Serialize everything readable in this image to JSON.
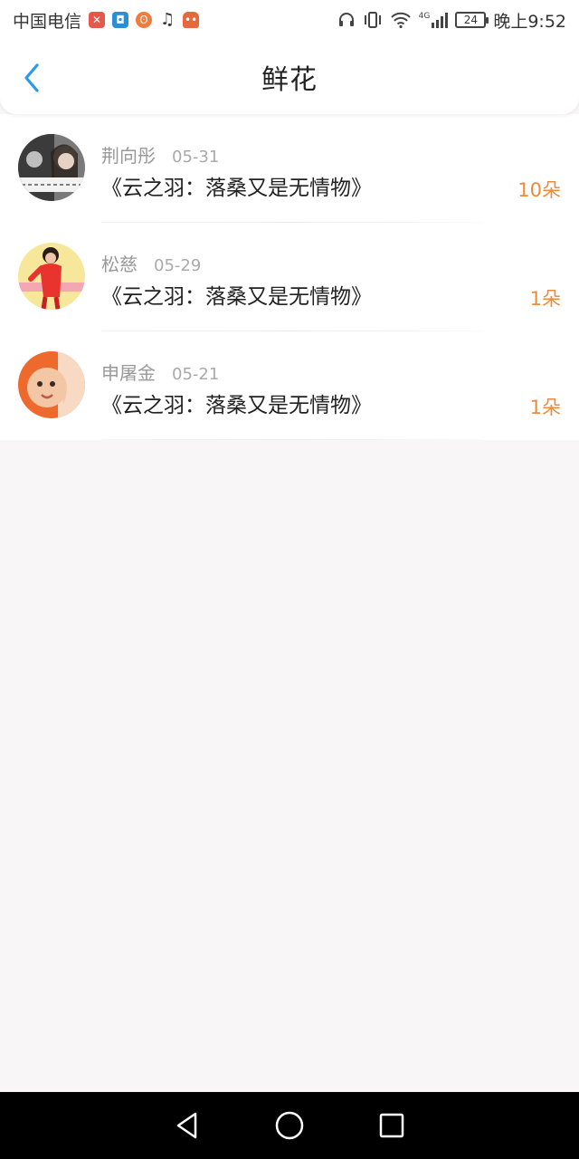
{
  "status_bar": {
    "carrier": "中国电信",
    "network": "4G",
    "battery": "24",
    "time": "晚上9:52",
    "app_icons": [
      "weibo-icon",
      "shield-app-icon",
      "sina-icon",
      "music-note-icon",
      "robot-app-icon"
    ]
  },
  "header": {
    "title": "鲜花",
    "back_icon": "chevron-left-icon"
  },
  "list": {
    "items": [
      {
        "name": "荆向彤",
        "date": "05-31",
        "title": "《云之羽：落桑又是无情物》",
        "count": "10朵"
      },
      {
        "name": "松慈",
        "date": "05-29",
        "title": "《云之羽：落桑又是无情物》",
        "count": "1朵"
      },
      {
        "name": "申屠金",
        "date": "05-21",
        "title": "《云之羽：落桑又是无情物》",
        "count": "1朵"
      }
    ]
  },
  "system_nav": {
    "back": "triangle-back-icon",
    "home": "circle-home-icon",
    "recents": "square-recents-icon"
  },
  "colors": {
    "accent_blue": "#2d9ae8",
    "count_orange": "#ee8a3a",
    "background": "#f8f6f7"
  }
}
